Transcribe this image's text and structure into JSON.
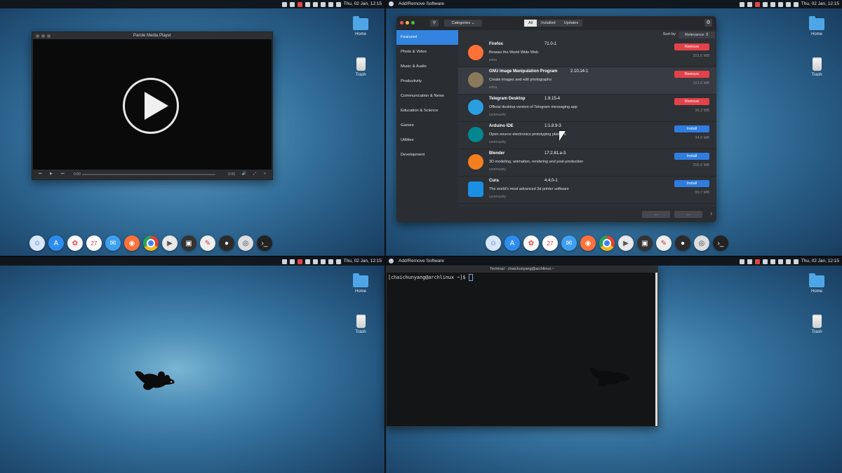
{
  "panel": {
    "active_app_ws2": "Add/Remove Software",
    "active_app_ws4": "Add/Remove Software",
    "clock": "Thu, 02 Jan, 12:15"
  },
  "desktop": {
    "home_label": "Home",
    "trash_label": "Trash"
  },
  "parole": {
    "title": "Parole Media Player",
    "time_elapsed": "0:00",
    "time_total": "0:00"
  },
  "dock": {
    "icons": [
      "finder-icon",
      "app-store-icon",
      "photos-icon",
      "calendar-icon",
      "mail-icon",
      "firefox-icon",
      "chrome-icon",
      "media-player-icon",
      "screenshot-icon",
      "draw-icon",
      "gimp-icon",
      "settings-icon",
      "terminal-icon"
    ],
    "calendar_day": "27"
  },
  "software": {
    "categories_button": "Categories",
    "tabs": [
      "All",
      "Installed",
      "Updates"
    ],
    "active_tab": "All",
    "sort_label": "Sort by",
    "sort_value": "Relevance",
    "sidebar": [
      "Featured",
      "Photo & Video",
      "Music & Audio",
      "Productivity",
      "Communication & News",
      "Education & Science",
      "Games",
      "Utilities",
      "Development"
    ],
    "selected_category": "Featured",
    "packages": [
      {
        "name": "Firefox",
        "version": "71.0-1",
        "desc": "Browse the World Wide Web",
        "repo": "extra",
        "action": "Remove",
        "size": "201.6 MB",
        "color": "#ff7139"
      },
      {
        "name": "GNU Image Manipulation Program",
        "version": "2.10.14-1",
        "desc": "Create images and edit photographs",
        "repo": "extra",
        "action": "Remove",
        "size": "101.6 MB",
        "color": "#8a7a5c"
      },
      {
        "name": "Telegram Desktop",
        "version": "1.9.15-4",
        "desc": "Official desktop version of Telegram messaging app",
        "repo": "community",
        "action": "Remove",
        "size": "36.2 MB",
        "color": "#2a9ee0"
      },
      {
        "name": "Arduino IDE",
        "version": "1:1.8.9-3",
        "desc": "Open-source electronics prototyping platform",
        "repo": "community",
        "action": "Install",
        "size": "34.6 MB",
        "color": "#00878f"
      },
      {
        "name": "Blender",
        "version": "17:2.81.a-3",
        "desc": "3D modeling, animation, rendering and post-production",
        "repo": "community",
        "action": "Install",
        "size": "255.0 MB",
        "color": "#f57f1f"
      },
      {
        "name": "Cura",
        "version": "4.4.0-1",
        "desc": "The world's most advanced 3d printer software",
        "repo": "community",
        "action": "Install",
        "size": "90.7 MB",
        "color": "#1b8fe3"
      }
    ]
  },
  "terminal": {
    "title": "Terminal - chaichunyang@archlinux:~",
    "prompt": "[chaichunyang@archlinux ~]$ "
  },
  "colors": {
    "accent": "#3284e0",
    "remove": "#e2424a"
  }
}
